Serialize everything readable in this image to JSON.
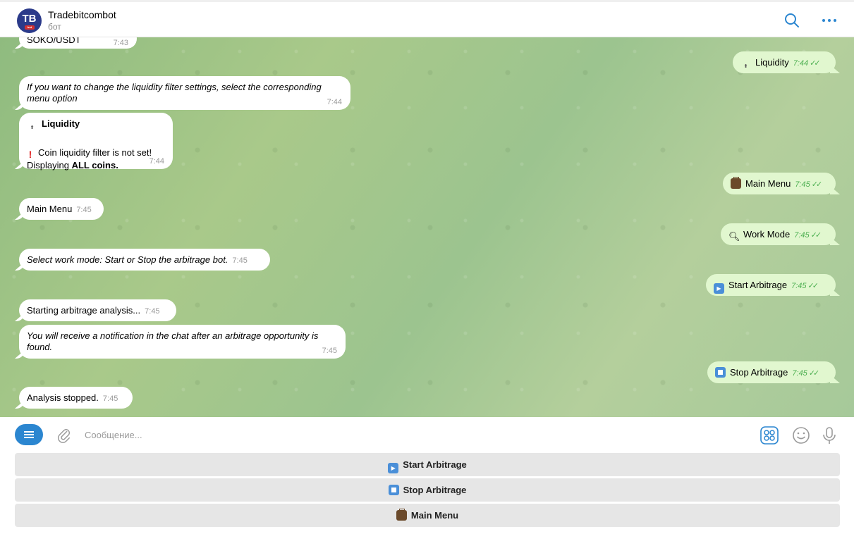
{
  "header": {
    "avatar_initials": "TB",
    "avatar_tag": "bot",
    "title": "Tradebitcombot",
    "subtitle": "бот"
  },
  "messages": {
    "m0": {
      "text": "SOKO/USDT",
      "time": "7:43"
    },
    "m1": {
      "icon": "top-arrow-icon",
      "text": "Liquidity",
      "time": "7:44"
    },
    "m2": {
      "text": "If you want to change the liquidity filter settings, select the corresponding menu option",
      "time": "7:44"
    },
    "m3": {
      "title": "Liquidity",
      "warning": "Coin liquidity filter is not set!",
      "line2_prefix": "Displaying ",
      "line2_bold": "ALL coins.",
      "time": "7:44"
    },
    "m4": {
      "icon": "briefcase-icon",
      "text": "Main Menu",
      "time": "7:45"
    },
    "m5": {
      "text": "Main Menu",
      "time": "7:45"
    },
    "m6": {
      "icon": "magnifier-icon",
      "text": "Work Mode",
      "time": "7:45"
    },
    "m7": {
      "text": "Select work mode: Start or Stop the arbitrage bot.",
      "time": "7:45"
    },
    "m8": {
      "icon": "play-button-icon",
      "text": "Start Arbitrage",
      "time": "7:45"
    },
    "m9": {
      "text": "Starting arbitrage analysis...",
      "time": "7:45"
    },
    "m10": {
      "text": "You will receive a notification in the chat after an arbitrage opportunity is found.",
      "time": "7:45"
    },
    "m11": {
      "icon": "stop-button-icon",
      "text": "Stop Arbitrage",
      "time": "7:45"
    },
    "m12": {
      "text": "Analysis stopped.",
      "time": "7:45"
    }
  },
  "composer": {
    "placeholder": "Сообщение..."
  },
  "keyboard": {
    "buttons": [
      {
        "icon": "play-button-icon",
        "label": "Start Arbitrage"
      },
      {
        "icon": "stop-button-icon",
        "label": "Stop Arbitrage"
      },
      {
        "icon": "briefcase-icon",
        "label": "Main Menu"
      }
    ]
  },
  "colors": {
    "accent": "#2b86d0",
    "incoming_bubble": "#ffffff",
    "outgoing_bubble": "#e1f7cf",
    "read_check": "#4caf50"
  }
}
